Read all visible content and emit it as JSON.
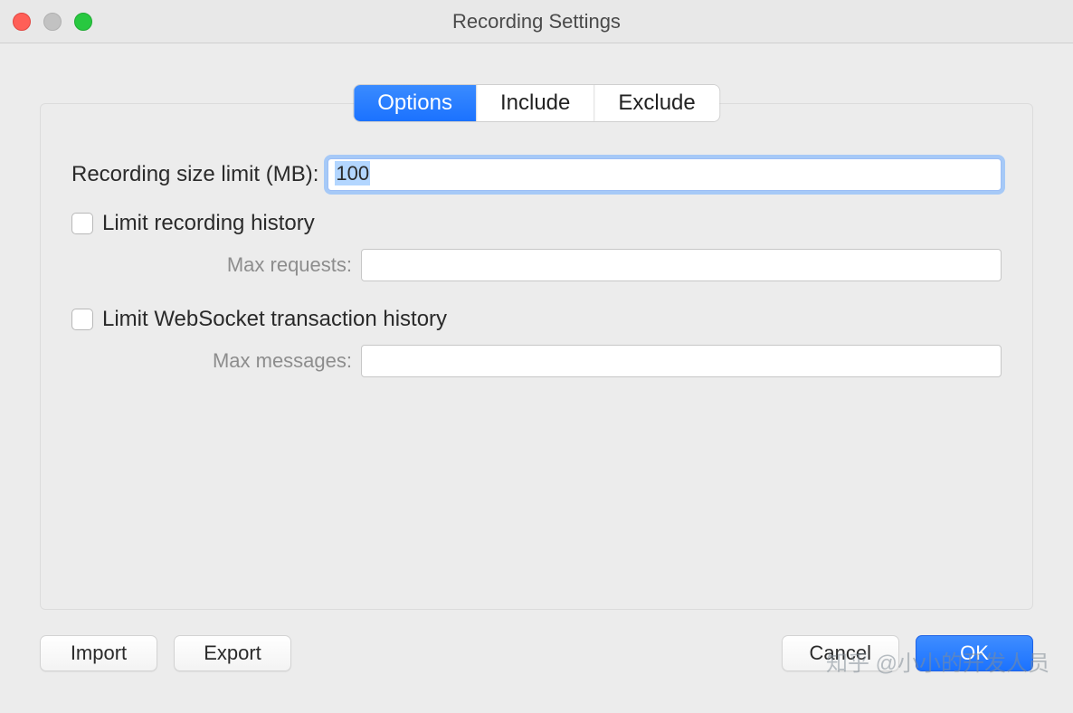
{
  "window": {
    "title": "Recording Settings"
  },
  "tabs": {
    "options": "Options",
    "include": "Include",
    "exclude": "Exclude",
    "active": "options"
  },
  "form": {
    "size_limit_label": "Recording size limit (MB):",
    "size_limit_value": "100",
    "limit_history_label": "Limit recording history",
    "limit_history_checked": false,
    "max_requests_label": "Max requests:",
    "max_requests_value": "",
    "limit_ws_label": "Limit WebSocket transaction history",
    "limit_ws_checked": false,
    "max_messages_label": "Max messages:",
    "max_messages_value": ""
  },
  "buttons": {
    "import": "Import",
    "export": "Export",
    "cancel": "Cancel",
    "ok": "OK"
  },
  "watermark": "知乎 @小小的开发人员"
}
